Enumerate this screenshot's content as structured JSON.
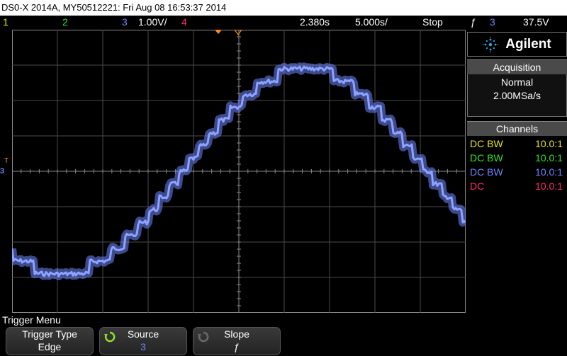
{
  "title": "DS0-X 2014A, MY50512221: Fri Aug 08 16:53:37 2014",
  "status": {
    "ch1": "1",
    "ch2": "2",
    "ch3": "3",
    "ch3_scale": "1.00V/",
    "ch4": "4",
    "time_delay": "2.380s",
    "time_scale": "5.000s/",
    "run_state": "Stop",
    "trigger_symbol": "ƒ",
    "trigger_channel": "3",
    "trigger_level": "37.5V"
  },
  "colors": {
    "ch1": "#e6e61e",
    "ch2": "#2ee62e",
    "ch3": "#6f86ff",
    "ch4": "#ff2a6e",
    "trigger_marker": "#ff8a1e"
  },
  "panel": {
    "brand": "Agilent",
    "acquisition_header": "Acquisition",
    "acquisition_mode": "Normal",
    "sample_rate": "2.00MSa/s",
    "channels_header": "Channels",
    "channels": [
      {
        "coupling": "DC BW",
        "probe": "10.0:1",
        "color": "#e6e61e"
      },
      {
        "coupling": "DC BW",
        "probe": "10.0:1",
        "color": "#2ee62e"
      },
      {
        "coupling": "DC BW",
        "probe": "10.0:1",
        "color": "#6f86ff"
      },
      {
        "coupling": "DC",
        "probe": "10.0:1",
        "color": "#ff2a6e"
      }
    ]
  },
  "trigger_menu": {
    "label": "Trigger Menu",
    "softkeys": [
      {
        "label": "Trigger Type",
        "value": "Edge"
      },
      {
        "label": "Source",
        "value": "3"
      },
      {
        "label": "Slope",
        "value": "ƒ"
      }
    ]
  },
  "ground_marker": "3",
  "trigger_t_marker": "T"
}
